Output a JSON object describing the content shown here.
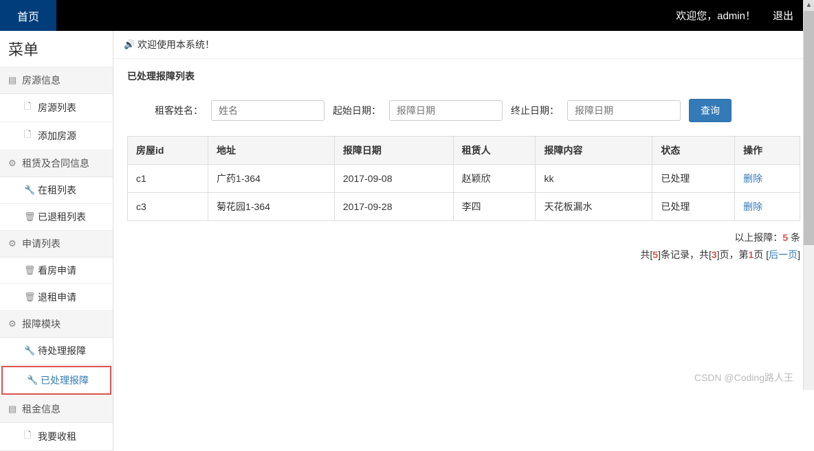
{
  "topbar": {
    "home": "首页",
    "welcome": "欢迎您，admin！",
    "logout": "退出"
  },
  "sidebar": {
    "title": "菜单",
    "groups": [
      {
        "label": "房源信息",
        "icon": "building",
        "items": [
          {
            "label": "房源列表",
            "icon": "file"
          },
          {
            "label": "添加房源",
            "icon": "file"
          }
        ]
      },
      {
        "label": "租赁及合同信息",
        "icon": "cog",
        "items": [
          {
            "label": "在租列表",
            "icon": "wrench"
          },
          {
            "label": "已退租列表",
            "icon": "trash"
          }
        ]
      },
      {
        "label": "申请列表",
        "icon": "cog",
        "items": [
          {
            "label": "看房申请",
            "icon": "trash"
          },
          {
            "label": "退租申请",
            "icon": "trash"
          }
        ]
      },
      {
        "label": "报障模块",
        "icon": "cog",
        "items": [
          {
            "label": "待处理报障",
            "icon": "wrench"
          },
          {
            "label": "已处理报障",
            "icon": "wrench",
            "active": true
          }
        ]
      },
      {
        "label": "租金信息",
        "icon": "building",
        "items": [
          {
            "label": "我要收租",
            "icon": "file"
          }
        ]
      }
    ]
  },
  "notice": "欢迎使用本系统！",
  "section_title": "已处理报障列表",
  "search": {
    "name_label": "租客姓名：",
    "name_ph": "姓名",
    "start_label": "起始日期：",
    "start_ph": "报障日期",
    "end_label": "终止日期：",
    "end_ph": "报障日期",
    "btn": "查询"
  },
  "table": {
    "headers": [
      "房屋id",
      "地址",
      "报障日期",
      "租赁人",
      "报障内容",
      "状态",
      "操作"
    ],
    "rows": [
      {
        "id": "c1",
        "addr": "广药1-364",
        "date": "2017-09-08",
        "tenant": "赵颖欣",
        "content": "kk",
        "status": "已处理",
        "op": "删除"
      },
      {
        "id": "c3",
        "addr": "菊花园1-364",
        "date": "2017-09-28",
        "tenant": "李四",
        "content": "天花板漏水",
        "status": "已处理",
        "op": "删除"
      }
    ]
  },
  "summary": {
    "line1_pre": "以上报障：",
    "line1_num": "5",
    "line1_suf": " 条",
    "line2_a": "共[",
    "line2_b": "5",
    "line2_c": "]条记录，共[",
    "line2_d": "3",
    "line2_e": "]页，第",
    "line2_f": "1",
    "line2_g": "页 [",
    "line2_link": "后一页",
    "line2_h": "]"
  },
  "watermark": "CSDN @Coding路人王"
}
